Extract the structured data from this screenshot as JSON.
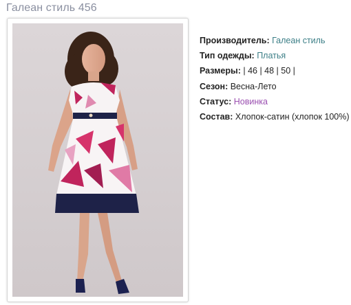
{
  "product": {
    "title": "Галеан стиль 456"
  },
  "properties": {
    "manufacturer_label": "Производитель:",
    "manufacturer_value": "Галеан стиль",
    "type_label": "Тип одежды:",
    "type_value": "Платья",
    "sizes_label": "Размеры:",
    "sizes_value": "| 46 | 48 | 50 |",
    "season_label": "Сезон:",
    "season_value": "Весна-Лето",
    "status_label": "Статус:",
    "status_value": "Новинка",
    "composition_label": "Состав:",
    "composition_value": "Хлопок-сатин (хлопок 100%)"
  },
  "colors": {
    "link": "#3b7e86",
    "status_link": "#9a4fb0",
    "title": "#8a8fa0"
  }
}
